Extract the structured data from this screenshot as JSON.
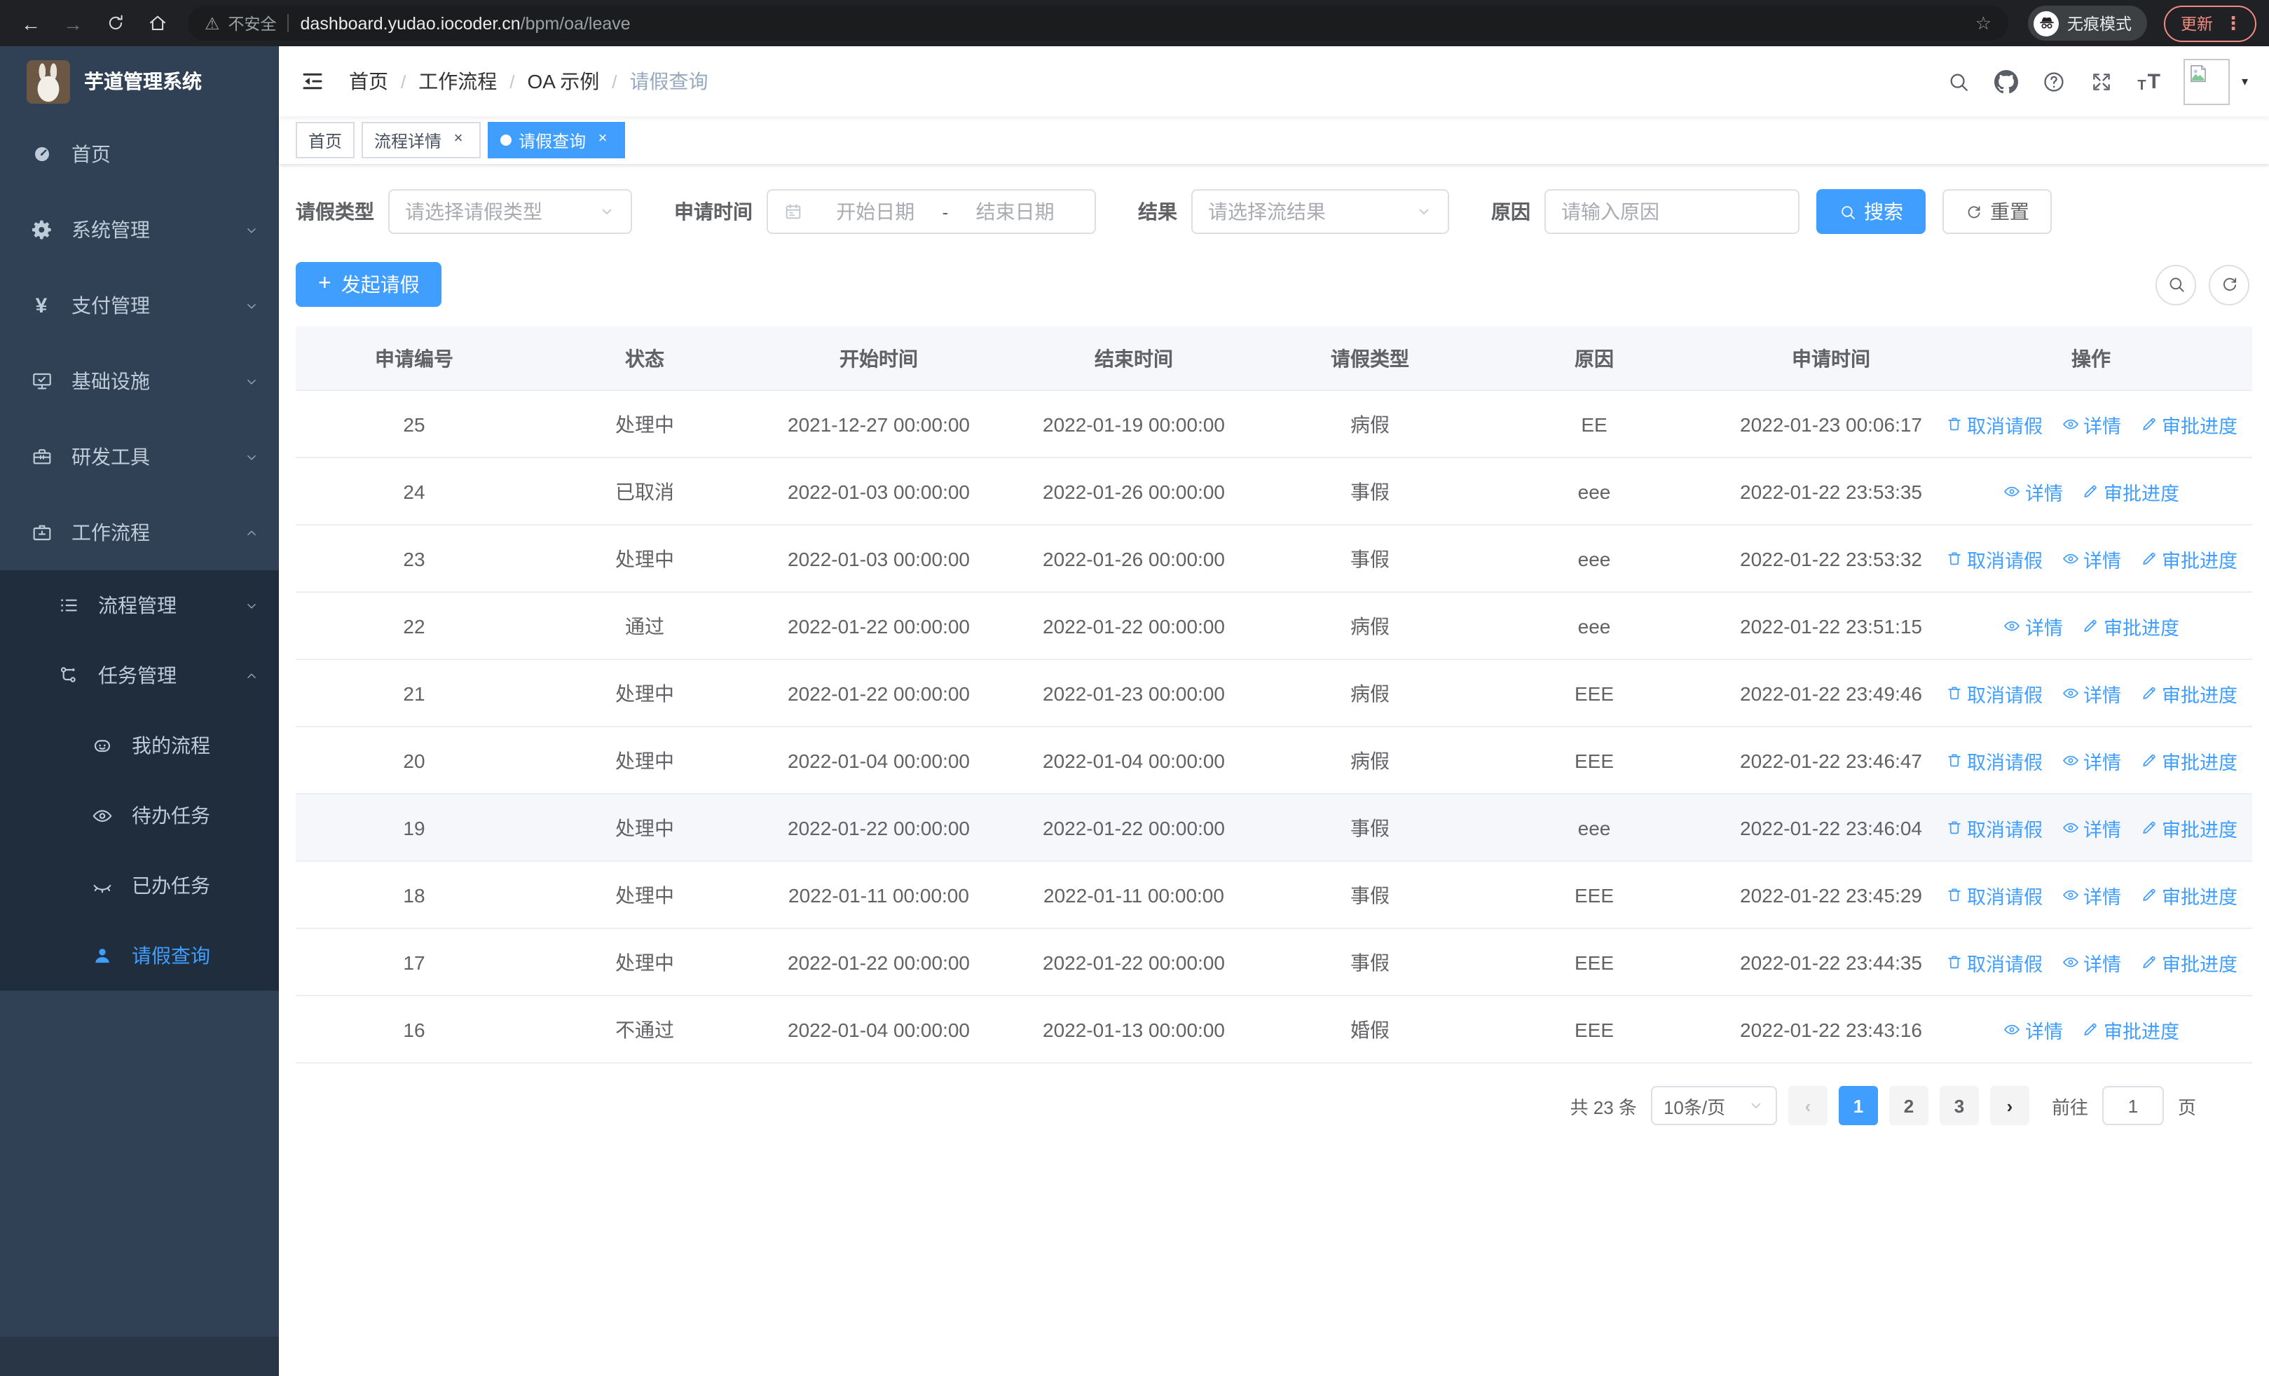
{
  "browser": {
    "security_label": "不安全",
    "url_domain": "dashboard.yudao.iocoder.cn",
    "url_path": "/bpm/oa/leave",
    "incognito_label": "无痕模式",
    "update_label": "更新"
  },
  "sidebar": {
    "logo_title": "芋道管理系统",
    "items": [
      {
        "name": "home",
        "label": "首页",
        "icon": "dashboard-icon"
      },
      {
        "name": "system-management",
        "label": "系统管理",
        "icon": "gear-icon",
        "chevron": "down"
      },
      {
        "name": "payment-management",
        "label": "支付管理",
        "icon": "yen-icon",
        "chevron": "down"
      },
      {
        "name": "infrastructure",
        "label": "基础设施",
        "icon": "monitor-icon",
        "chevron": "down"
      },
      {
        "name": "dev-tools",
        "label": "研发工具",
        "icon": "toolbox-icon",
        "chevron": "down"
      },
      {
        "name": "workflow",
        "label": "工作流程",
        "icon": "briefcase-icon",
        "chevron": "up"
      }
    ],
    "submenu": [
      {
        "name": "process-management",
        "label": "流程管理",
        "icon": "list-icon",
        "chevron": "down",
        "level": 1
      },
      {
        "name": "task-management",
        "label": "任务管理",
        "icon": "flow-icon",
        "chevron": "up",
        "level": 1
      },
      {
        "name": "my-process",
        "label": "我的流程",
        "icon": "robot-icon",
        "level": 2
      },
      {
        "name": "todo-tasks",
        "label": "待办任务",
        "icon": "eye-icon",
        "level": 2
      },
      {
        "name": "done-tasks",
        "label": "已办任务",
        "icon": "eye-closed-icon",
        "level": 2
      },
      {
        "name": "leave-query",
        "label": "请假查询",
        "icon": "user-icon",
        "level": 2,
        "active": true
      }
    ]
  },
  "navbar": {
    "breadcrumb": [
      {
        "label": "首页",
        "link": true
      },
      {
        "label": "工作流程",
        "link": true
      },
      {
        "label": "OA 示例",
        "link": true
      },
      {
        "label": "请假查询",
        "link": false
      }
    ]
  },
  "tabs": [
    {
      "name": "home",
      "label": "首页",
      "closable": false,
      "active": false
    },
    {
      "name": "process-detail",
      "label": "流程详情",
      "closable": true,
      "active": false
    },
    {
      "name": "leave-query",
      "label": "请假查询",
      "closable": true,
      "active": true
    }
  ],
  "filters": {
    "leave_type": {
      "label": "请假类型",
      "placeholder": "请选择请假类型"
    },
    "apply_time": {
      "label": "申请时间",
      "start_placeholder": "开始日期",
      "separator": "-",
      "end_placeholder": "结束日期"
    },
    "result": {
      "label": "结果",
      "placeholder": "请选择流结果"
    },
    "reason": {
      "label": "原因",
      "placeholder": "请输入原因"
    },
    "search_label": "搜索",
    "reset_label": "重置"
  },
  "toolbar": {
    "create_label": "发起请假"
  },
  "table": {
    "columns": [
      "申请编号",
      "状态",
      "开始时间",
      "结束时间",
      "请假类型",
      "原因",
      "申请时间",
      "操作"
    ],
    "rows": [
      {
        "id": "25",
        "status": "处理中",
        "start": "2021-12-27 00:00:00",
        "end": "2022-01-19 00:00:00",
        "type": "病假",
        "reason": "EE",
        "apply_time": "2022-01-23 00:06:17",
        "actions": [
          {
            "label": "取消请假",
            "icon": "trash"
          },
          {
            "label": "详情",
            "icon": "view"
          },
          {
            "label": "审批进度",
            "icon": "edit"
          }
        ]
      },
      {
        "id": "24",
        "status": "已取消",
        "start": "2022-01-03 00:00:00",
        "end": "2022-01-26 00:00:00",
        "type": "事假",
        "reason": "eee",
        "apply_time": "2022-01-22 23:53:35",
        "actions": [
          {
            "label": "详情",
            "icon": "view"
          },
          {
            "label": "审批进度",
            "icon": "edit"
          }
        ]
      },
      {
        "id": "23",
        "status": "处理中",
        "start": "2022-01-03 00:00:00",
        "end": "2022-01-26 00:00:00",
        "type": "事假",
        "reason": "eee",
        "apply_time": "2022-01-22 23:53:32",
        "actions": [
          {
            "label": "取消请假",
            "icon": "trash"
          },
          {
            "label": "详情",
            "icon": "view"
          },
          {
            "label": "审批进度",
            "icon": "edit"
          }
        ]
      },
      {
        "id": "22",
        "status": "通过",
        "start": "2022-01-22 00:00:00",
        "end": "2022-01-22 00:00:00",
        "type": "病假",
        "reason": "eee",
        "apply_time": "2022-01-22 23:51:15",
        "actions": [
          {
            "label": "详情",
            "icon": "view"
          },
          {
            "label": "审批进度",
            "icon": "edit"
          }
        ]
      },
      {
        "id": "21",
        "status": "处理中",
        "start": "2022-01-22 00:00:00",
        "end": "2022-01-23 00:00:00",
        "type": "病假",
        "reason": "EEE",
        "apply_time": "2022-01-22 23:49:46",
        "actions": [
          {
            "label": "取消请假",
            "icon": "trash"
          },
          {
            "label": "详情",
            "icon": "view"
          },
          {
            "label": "审批进度",
            "icon": "edit"
          }
        ]
      },
      {
        "id": "20",
        "status": "处理中",
        "start": "2022-01-04 00:00:00",
        "end": "2022-01-04 00:00:00",
        "type": "病假",
        "reason": "EEE",
        "apply_time": "2022-01-22 23:46:47",
        "actions": [
          {
            "label": "取消请假",
            "icon": "trash"
          },
          {
            "label": "详情",
            "icon": "view"
          },
          {
            "label": "审批进度",
            "icon": "edit"
          }
        ]
      },
      {
        "id": "19",
        "status": "处理中",
        "start": "2022-01-22 00:00:00",
        "end": "2022-01-22 00:00:00",
        "type": "事假",
        "reason": "eee",
        "apply_time": "2022-01-22 23:46:04",
        "highlighted": true,
        "actions": [
          {
            "label": "取消请假",
            "icon": "trash"
          },
          {
            "label": "详情",
            "icon": "view"
          },
          {
            "label": "审批进度",
            "icon": "edit"
          }
        ]
      },
      {
        "id": "18",
        "status": "处理中",
        "start": "2022-01-11 00:00:00",
        "end": "2022-01-11 00:00:00",
        "type": "事假",
        "reason": "EEE",
        "apply_time": "2022-01-22 23:45:29",
        "actions": [
          {
            "label": "取消请假",
            "icon": "trash"
          },
          {
            "label": "详情",
            "icon": "view"
          },
          {
            "label": "审批进度",
            "icon": "edit"
          }
        ]
      },
      {
        "id": "17",
        "status": "处理中",
        "start": "2022-01-22 00:00:00",
        "end": "2022-01-22 00:00:00",
        "type": "事假",
        "reason": "EEE",
        "apply_time": "2022-01-22 23:44:35",
        "actions": [
          {
            "label": "取消请假",
            "icon": "trash"
          },
          {
            "label": "详情",
            "icon": "view"
          },
          {
            "label": "审批进度",
            "icon": "edit"
          }
        ]
      },
      {
        "id": "16",
        "status": "不通过",
        "start": "2022-01-04 00:00:00",
        "end": "2022-01-13 00:00:00",
        "type": "婚假",
        "reason": "EEE",
        "apply_time": "2022-01-22 23:43:16",
        "actions": [
          {
            "label": "详情",
            "icon": "view"
          },
          {
            "label": "审批进度",
            "icon": "edit"
          }
        ]
      }
    ]
  },
  "pagination": {
    "total_label": "共 23 条",
    "page_size_value": "10条/页",
    "pages": [
      "1",
      "2",
      "3"
    ],
    "active_page": "1",
    "goto_label": "前往",
    "goto_value": "1",
    "page_suffix": "页"
  }
}
